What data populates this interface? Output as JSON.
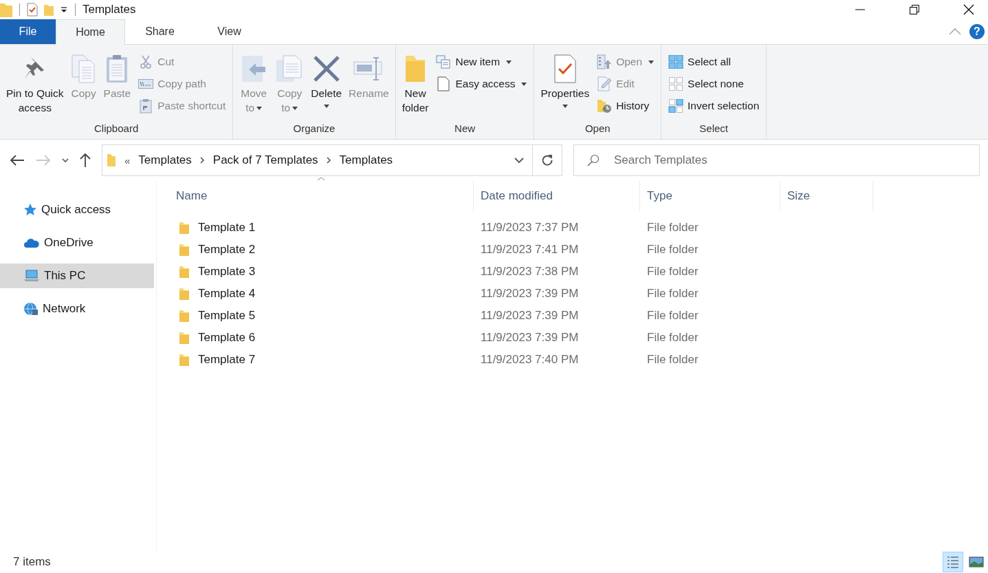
{
  "window": {
    "title": "Templates"
  },
  "tabs": [
    {
      "label": "File",
      "kind": "file",
      "selected": false
    },
    {
      "label": "Home",
      "kind": "tab",
      "selected": true
    },
    {
      "label": "Share",
      "kind": "tab",
      "selected": false
    },
    {
      "label": "View",
      "kind": "tab",
      "selected": false
    }
  ],
  "help": "?",
  "ribbon": [
    {
      "label": "Clipboard",
      "items": [
        {
          "kind": "large",
          "label": "Pin to Quick\naccess",
          "disabled": false,
          "dropdown": false
        },
        {
          "kind": "large",
          "label": "Copy",
          "disabled": true,
          "dropdown": false
        },
        {
          "kind": "large",
          "label": "Paste",
          "disabled": true,
          "dropdown": false
        },
        {
          "kind": "small",
          "label": "Cut",
          "disabled": true,
          "dropdown": false
        },
        {
          "kind": "small",
          "label": "Copy path",
          "disabled": true,
          "dropdown": false
        },
        {
          "kind": "small",
          "label": "Paste shortcut",
          "disabled": true,
          "dropdown": false
        }
      ]
    },
    {
      "label": "Organize",
      "items": [
        {
          "kind": "large",
          "label": "Move\nto",
          "disabled": true,
          "dropdown": true
        },
        {
          "kind": "large",
          "label": "Copy\nto",
          "disabled": true,
          "dropdown": true
        },
        {
          "kind": "large",
          "label": "Delete",
          "disabled": false,
          "dropdown": true
        },
        {
          "kind": "large",
          "label": "Rename",
          "disabled": true,
          "dropdown": false
        }
      ]
    },
    {
      "label": "New",
      "items": [
        {
          "kind": "large",
          "label": "New\nfolder",
          "disabled": false,
          "dropdown": false
        },
        {
          "kind": "small",
          "label": "New item",
          "disabled": false,
          "dropdown": true
        },
        {
          "kind": "small",
          "label": "Easy access",
          "disabled": false,
          "dropdown": true
        }
      ]
    },
    {
      "label": "Open",
      "items": [
        {
          "kind": "large",
          "label": "Properties",
          "disabled": false,
          "dropdown": true
        },
        {
          "kind": "small",
          "label": "Open",
          "disabled": true,
          "dropdown": true
        },
        {
          "kind": "small",
          "label": "Edit",
          "disabled": true,
          "dropdown": false
        },
        {
          "kind": "small",
          "label": "History",
          "disabled": false,
          "dropdown": false
        }
      ]
    },
    {
      "label": "Select",
      "items": [
        {
          "kind": "small",
          "label": "Select all",
          "disabled": false,
          "dropdown": false
        },
        {
          "kind": "small",
          "label": "Select none",
          "disabled": false,
          "dropdown": false
        },
        {
          "kind": "small",
          "label": "Invert selection",
          "disabled": false,
          "dropdown": false
        }
      ]
    }
  ],
  "navigation": {
    "forward_disabled": true
  },
  "address": {
    "overflow": "«",
    "crumbs": [
      "Templates",
      "Pack of 7 Templates",
      "Templates"
    ]
  },
  "search": {
    "placeholder": "Search Templates"
  },
  "sidebar": {
    "items": [
      {
        "label": "Quick access",
        "selected": false
      },
      {
        "label": "OneDrive",
        "selected": false
      },
      {
        "label": "This PC",
        "selected": true
      },
      {
        "label": "Network",
        "selected": false
      }
    ]
  },
  "table": {
    "columns": [
      "Name",
      "Date modified",
      "Type",
      "Size"
    ],
    "rows": [
      {
        "name": "Template 1",
        "date": "11/9/2023 7:37 PM",
        "type": "File folder"
      },
      {
        "name": "Template 2",
        "date": "11/9/2023 7:41 PM",
        "type": "File folder"
      },
      {
        "name": "Template 3",
        "date": "11/9/2023 7:38 PM",
        "type": "File folder"
      },
      {
        "name": "Template 4",
        "date": "11/9/2023 7:39 PM",
        "type": "File folder"
      },
      {
        "name": "Template 5",
        "date": "11/9/2023 7:39 PM",
        "type": "File folder"
      },
      {
        "name": "Template 6",
        "date": "11/9/2023 7:39 PM",
        "type": "File folder"
      },
      {
        "name": "Template 7",
        "date": "11/9/2023 7:40 PM",
        "type": "File folder"
      }
    ]
  },
  "status_bar": {
    "count": "7 items",
    "views": [
      {
        "selected": true
      },
      {
        "selected": false
      }
    ]
  }
}
